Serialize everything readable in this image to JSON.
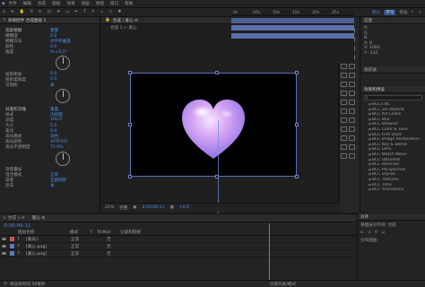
{
  "menu": [
    "文件",
    "编辑",
    "合成",
    "图层",
    "效果",
    "动画",
    "视图",
    "窗口",
    "帮助"
  ],
  "toolbar": {
    "workspace_default": "默认",
    "workspace_learn": "学习",
    "workspace_standard": "标准",
    "workspace_active": "默认",
    "search_icon": "search-icon"
  },
  "effect_controls": {
    "tab_label": "效果控件 合成图层 1",
    "rows": [
      {
        "name": "高斯模糊",
        "value": "重置",
        "head": true
      },
      {
        "name": "模糊度",
        "value": "0.0"
      },
      {
        "name": "模糊方向",
        "value": "水平和垂直"
      },
      {
        "name": "颜色",
        "value": "0.0"
      },
      {
        "name": "角度",
        "value": "0x+0.0°"
      }
    ],
    "rows2": [
      {
        "name": "投影距离",
        "value": "0.0"
      },
      {
        "name": "投影柔和度",
        "value": "0.0"
      },
      {
        "name": "仅阴影",
        "value": "关"
      }
    ],
    "section2": [
      {
        "name": "斜面和浮雕",
        "value": "重置",
        "head": true
      },
      {
        "name": "样式",
        "value": "内斜面"
      },
      {
        "name": "深度",
        "value": "100.0"
      },
      {
        "name": "大小",
        "value": "5.0"
      },
      {
        "name": "柔化",
        "value": "0.0"
      },
      {
        "name": "高光模式",
        "value": "滤色"
      },
      {
        "name": "高光颜色",
        "value": "#FFFFFF"
      },
      {
        "name": "高光不透明度",
        "value": "75.0%"
      }
    ],
    "section3": [
      {
        "name": "渐变叠加",
        "value": ""
      },
      {
        "name": "混合模式",
        "value": "正常"
      },
      {
        "name": "渐变",
        "value": "全部阴影"
      },
      {
        "name": "反向",
        "value": "关"
      }
    ]
  },
  "comp": {
    "tab_label": "合成 | 爱心 ≡",
    "breadcrumb": "合成 1 ← 爱心",
    "bottom": [
      "25%",
      "完整",
      "0:00:00:11",
      "+0.0"
    ]
  },
  "right": {
    "info_tab": "信息",
    "info_lines": [
      "R:",
      "G:",
      "B:",
      "A: 0",
      "X: 1060",
      "Y: -132"
    ],
    "tracker_tab": "跟踪器",
    "effects_tab": "效果和预设",
    "effects_search": "",
    "effects_list": [
      "BCC3 BC",
      "BCC 3D Objects",
      "BCC Art Looks",
      "BCC Blur",
      "BCC Browser",
      "BCC Color & Tone",
      "BCC Film Style",
      "BCC Image Restoration",
      "BCC Key & Blend",
      "BCC Lens",
      "BCC Match Move",
      "BCC Obsolete",
      "BCC Particles",
      "BCC Perspective",
      "BCC Stylize",
      "BCC Textures",
      "BCC Time",
      "BCC Transitions"
    ]
  },
  "timeline": {
    "tab_label": "合成 1 ≡",
    "tab2_label": "爱心 ≡",
    "time": "0:00:00:11",
    "columns": [
      "图层名称",
      "模式",
      "T",
      "TrkMat",
      "父级和链接"
    ],
    "layers": [
      {
        "num": "1",
        "name": "[高光]",
        "mode": "正常",
        "parent": "无",
        "color": "#c45a5a"
      },
      {
        "num": "2",
        "name": "[爱心 png]",
        "mode": "正常",
        "parent": "无",
        "color": "#5a7ac4"
      },
      {
        "num": "3",
        "name": "[爱心.png]",
        "mode": "正常",
        "parent": "无",
        "color": "#5a7ac4"
      }
    ],
    "ruler": [
      "0s",
      "05s",
      "10s",
      "15s",
      "20s",
      "25s"
    ],
    "status": "帧渲染时间 59毫秒",
    "toggle_label": "切换开关/模式"
  },
  "side_panel": {
    "title": "对齐",
    "line1": "将图层对齐到: 合成",
    "line2": "分布图层:"
  },
  "accent_color": "#4b8ff0",
  "playhead_color": "#3b8cff"
}
